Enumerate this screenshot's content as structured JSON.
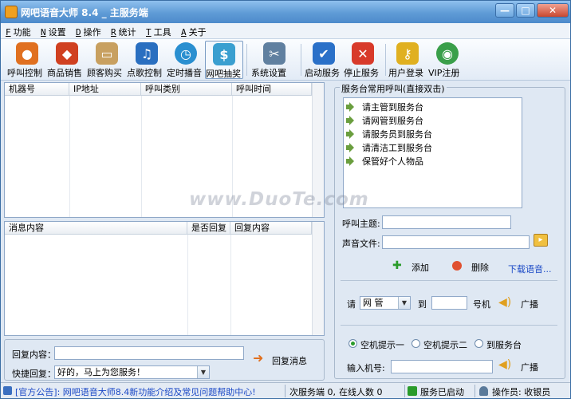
{
  "window": {
    "title": "网吧语音大师 8.4 _ 主服务端",
    "min": "—",
    "max": "□",
    "close": "✕"
  },
  "menu": [
    {
      "key": "F",
      "label": "功能"
    },
    {
      "key": "N",
      "label": "设置"
    },
    {
      "key": "D",
      "label": "操作"
    },
    {
      "key": "R",
      "label": "统计"
    },
    {
      "key": "T",
      "label": "工具"
    },
    {
      "key": "A",
      "label": "关于"
    }
  ],
  "toolbar": [
    {
      "label": "呼叫控制",
      "icon": "user-icon",
      "color": "#e07020"
    },
    {
      "label": "商品销售",
      "icon": "package-icon",
      "color": "#d04020"
    },
    {
      "label": "顾客购买",
      "icon": "card-icon",
      "color": "#c8a060"
    },
    {
      "label": "点歌控制",
      "icon": "music-note-icon",
      "color": "#2a6fc0"
    },
    {
      "label": "定时播音",
      "icon": "clock-icon",
      "color": "#2a8fd0"
    },
    {
      "label": "网吧抽奖",
      "icon": "lottery-icon",
      "color": "#3a9fd0"
    },
    {
      "label": "系统设置",
      "icon": "tools-icon",
      "color": "#6080a0"
    },
    {
      "label": "启动服务",
      "icon": "shield-icon",
      "color": "#2a70c8"
    },
    {
      "label": "停止服务",
      "icon": "stop-shield-icon",
      "color": "#d83a2a"
    },
    {
      "label": "用户登录",
      "icon": "key-icon",
      "color": "#e0b020"
    },
    {
      "label": "VIP注册",
      "icon": "globe-icon",
      "color": "#3a9f4a"
    }
  ],
  "call_table": {
    "columns": [
      "机器号",
      "IP地址",
      "呼叫类别",
      "呼叫时间"
    ]
  },
  "msg_table": {
    "columns": [
      "消息内容",
      "是否回复",
      "回复内容"
    ]
  },
  "reply": {
    "content_label": "回复内容：",
    "content_value": "",
    "quick_label": "快捷回复：",
    "quick_value": "好的，马上为您服务！",
    "send_button": "回复消息"
  },
  "service_panel": {
    "group_title": "服务台常用呼叫(直接双击)",
    "calls": [
      "请主管到服务台",
      "请网管到服务台",
      "请服务员到服务台",
      "请清洁工到服务台",
      "保管好个人物品"
    ],
    "topic_label": "呼叫主题:",
    "topic_value": "",
    "sound_label": "声音文件:",
    "sound_value": "",
    "add_button": "添加",
    "delete_button": "删除",
    "download_link": "下载语音...",
    "please_label": "请",
    "staff_select": "网 管",
    "to_label": "到",
    "machine_no": "",
    "machine_label": "号机",
    "broadcast1": "广播",
    "radio_options": [
      "空机提示一",
      "空机提示二",
      "到服务台"
    ],
    "input_label": "输入机号:",
    "input_value": "",
    "broadcast2": "广播"
  },
  "status": {
    "notice": "[官方公告]: 网吧语音大师8.4新功能介绍及常见问题帮助中心!",
    "service_count": "次服务端 0,",
    "online_count": "在线人数 0",
    "service_state": "服务已启动",
    "operator": "操作员: 收银员"
  },
  "watermark": "www.DuoTe.com"
}
